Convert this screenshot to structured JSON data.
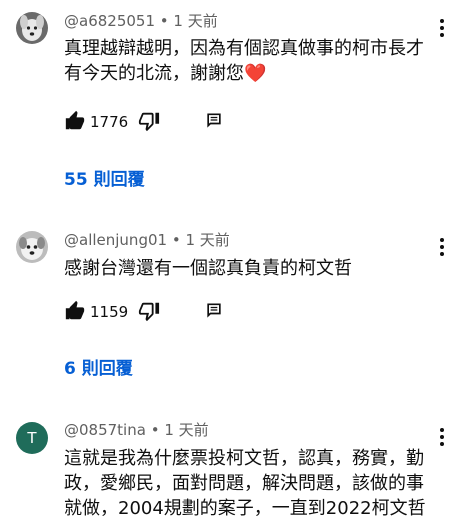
{
  "comments": [
    {
      "author": "@a6825051",
      "time": "1 天前",
      "text": "真理越辯越明，因為有個認真做事的柯市長才\n有今天的北流，謝謝您",
      "heart": "❤️",
      "likes": "1776",
      "replies": "55 則回覆",
      "avatar_icon": "dog-avatar"
    },
    {
      "author": "@allenjung01",
      "time": "1 天前",
      "text": "感謝台灣還有一個認真負責的柯文哲",
      "likes": "1159",
      "replies": "6 則回覆",
      "avatar_icon": "dog-avatar"
    },
    {
      "author": "@0857tina",
      "time": "1 天前",
      "text": "這就是我為什麼票投柯文哲，認真，務實，勤\n政，愛鄉民，面對問題，解決問題，該做的事\n就做，2004規劃的案子，一直到2022柯文哲",
      "avatar_letter": "T",
      "avatar_color": "#1f6c5a"
    }
  ],
  "separator": " • ",
  "colors": {
    "reply_link": "#065fd4",
    "meta": "#606060",
    "heart": "#e0245e"
  },
  "icons": {
    "like": "thumbs-up-icon",
    "dislike": "thumbs-down-icon",
    "reply": "comment-icon",
    "more": "more-vert-icon"
  }
}
